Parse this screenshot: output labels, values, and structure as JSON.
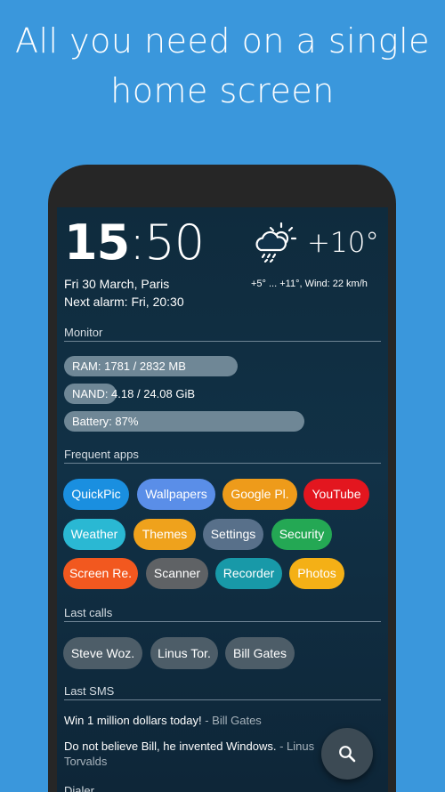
{
  "promo": {
    "line1": "All you need on a single",
    "line2": "home screen"
  },
  "clock": {
    "hours": "15",
    "minutes": ":50"
  },
  "date_location": "Fri 30 March, Paris",
  "next_alarm": "Next alarm: Fri, 20:30",
  "weather": {
    "icon": "cloud-sun-rain-icon",
    "temperature": "+10°",
    "detail": "+5° ... +11°, Wind: 22 km/h"
  },
  "monitor": {
    "title": "Monitor",
    "bars": [
      {
        "label": "RAM: 1781 / 2832 MB",
        "fraction": 0.63
      },
      {
        "label": "NAND: 4.18 / 24.08 GiB",
        "fraction": 0.17
      },
      {
        "label": "Battery: 87%",
        "fraction": 0.87
      }
    ]
  },
  "frequent_apps": {
    "title": "Frequent apps",
    "apps": [
      {
        "label": "QuickPic",
        "color": "#1a8fe0"
      },
      {
        "label": "Wallpapers",
        "color": "#5a8ee8"
      },
      {
        "label": "Google Pl.",
        "color": "#ee9b1a"
      },
      {
        "label": "YouTube",
        "color": "#e3161f"
      },
      {
        "label": "Weather",
        "color": "#2ab8d3"
      },
      {
        "label": "Themes",
        "color": "#efa21c"
      },
      {
        "label": "Settings",
        "color": "#58708a"
      },
      {
        "label": "Security",
        "color": "#24a854"
      },
      {
        "label": "Screen Re.",
        "color": "#f2581f"
      },
      {
        "label": "Scanner",
        "color": "#5f6265"
      },
      {
        "label": "Recorder",
        "color": "#1899a8"
      },
      {
        "label": "Photos",
        "color": "#f4b016"
      }
    ]
  },
  "last_calls": {
    "title": "Last calls",
    "contacts": [
      "Steve Woz.",
      "Linus Tor.",
      "Bill Gates"
    ]
  },
  "last_sms": {
    "title": "Last SMS",
    "messages": [
      {
        "text": "Win 1 million dollars today!",
        "from": " - Bill Gates"
      },
      {
        "text": "Do not believe Bill, he invented Windows.",
        "from": " - Linus Torvalds"
      }
    ]
  },
  "next_section_title": "Dialer",
  "fab": {
    "icon": "search-icon"
  }
}
